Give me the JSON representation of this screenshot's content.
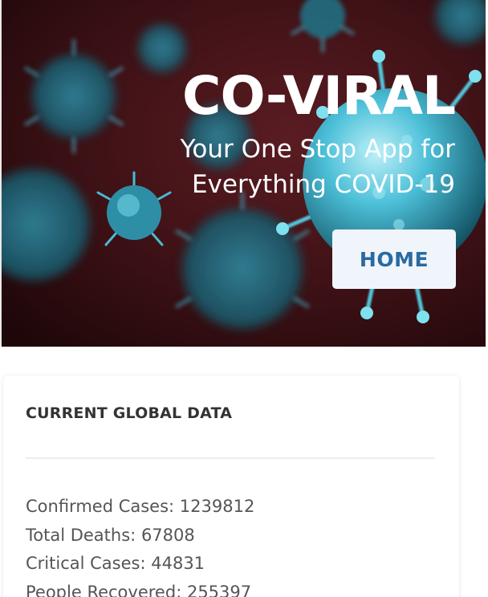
{
  "hero": {
    "title": "CO-VIRAL",
    "subtitle": "Your One Stop App for Everything COVID-19",
    "home_button_label": "HOME"
  },
  "global_data": {
    "heading": "CURRENT GLOBAL DATA",
    "stats": [
      {
        "label": "Confirmed Cases",
        "value": "1239812"
      },
      {
        "label": "Total Deaths",
        "value": "67808"
      },
      {
        "label": "Critical Cases",
        "value": "44831"
      },
      {
        "label": "People Recovered",
        "value": "255397"
      }
    ]
  },
  "colors": {
    "hero_background": "#3a1014",
    "virus_cyan": "#3fb6d0",
    "button_background": "#f0f5fb",
    "button_text": "#2a6aa0",
    "heading_text": "#333333",
    "body_text": "#555555"
  }
}
